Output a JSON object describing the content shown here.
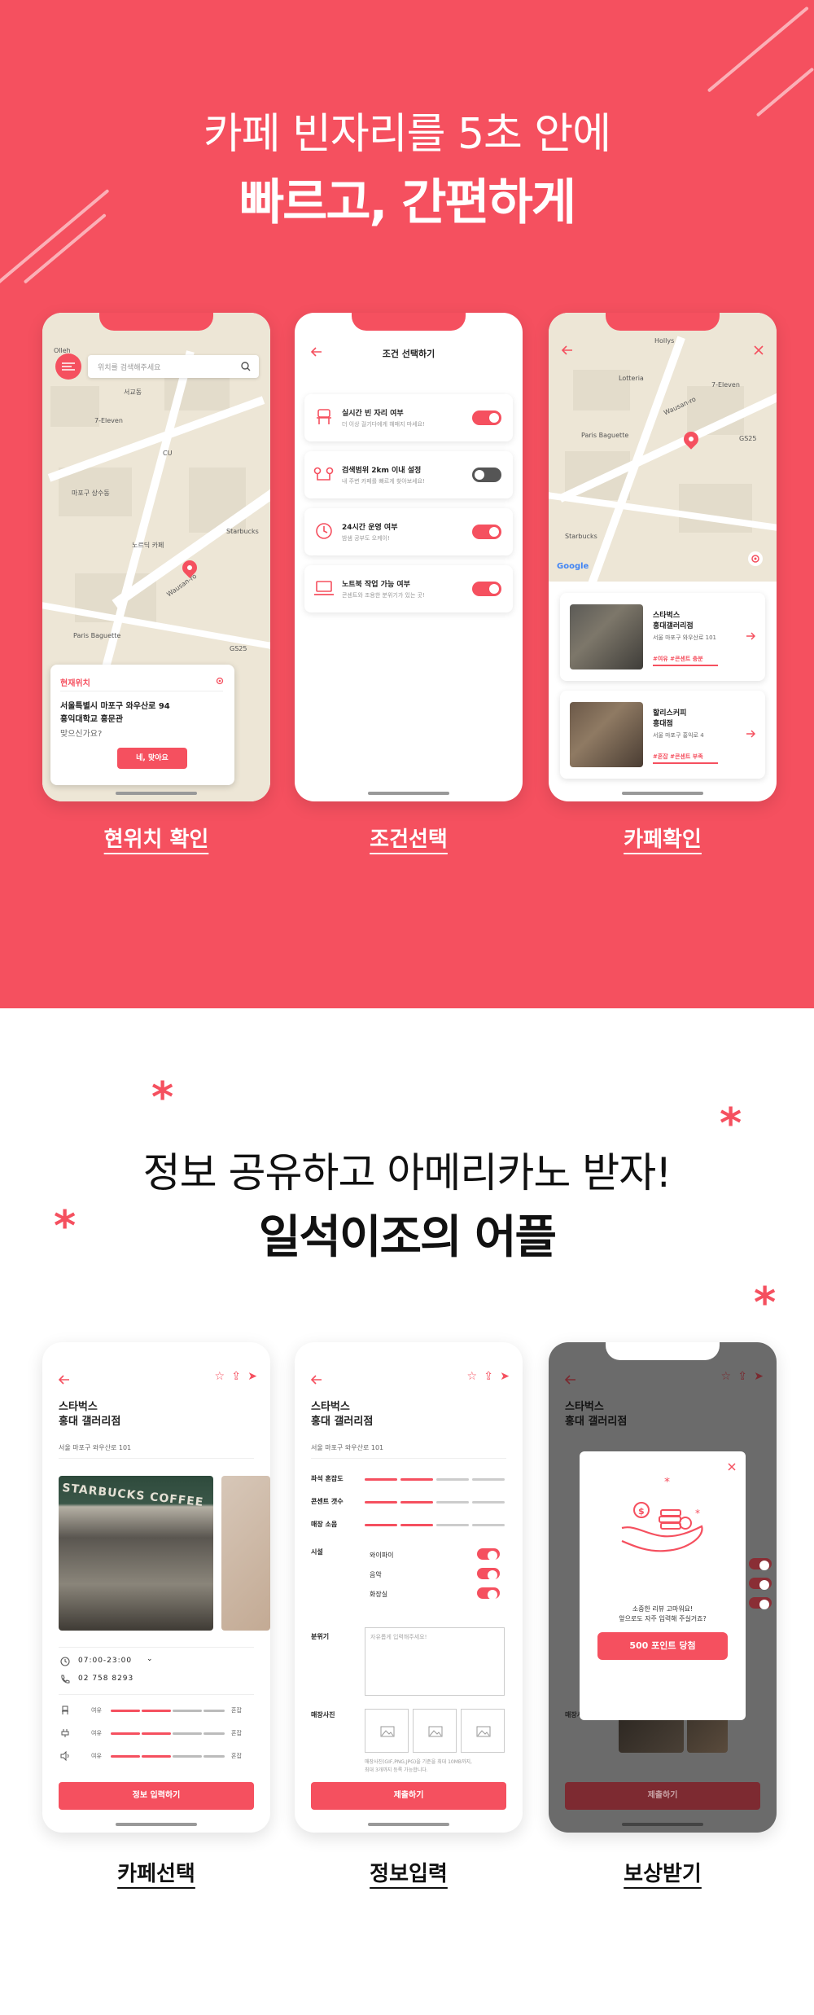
{
  "hero": {
    "line1": "카페 빈자리를 5초 안에",
    "line2": "빠르고, 간편하게"
  },
  "colors": {
    "accent": "#f5505f",
    "dark_gray": "#6b6b6b"
  },
  "screen1": {
    "search_placeholder": "위치를 검색해주세요",
    "card_title": "현재위치",
    "address": "서울특별시 마포구 와우산로 94",
    "place": "홍익대학교 홍문관",
    "question": "맞으신가요?",
    "confirm": "네, 맞아요",
    "map_labels": [
      "Olleh",
      "7-Eleven",
      "서교동",
      "CU",
      "Starbucks",
      "Paris Baguette",
      "Wausan-ro",
      "GS25",
      "노르딕 카페",
      "마포구 상수동"
    ],
    "caption": "현위치 확인"
  },
  "screen2": {
    "title": "조건 선택하기",
    "conditions": [
      {
        "title": "실시간 빈 자리 여부",
        "desc": "더 이상 걸기다에게 헤매지 마세요!",
        "icon": "chair-icon",
        "on": true
      },
      {
        "title": "검색범위 2km 이내 설정",
        "desc": "내 주변 카페를 빠르게 찾아보세요!",
        "icon": "route-icon",
        "on": false
      },
      {
        "title": "24시간 운영 여부",
        "desc": "밤샘 공부도 오케이!",
        "icon": "clock-icon",
        "on": true
      },
      {
        "title": "노트북 작업 가능 여부",
        "desc": "콘센트와 조용한 분위기가 있는 곳!",
        "icon": "laptop-icon",
        "on": true
      }
    ],
    "caption": "조건선택"
  },
  "screen3": {
    "map_labels": [
      "Hollys",
      "Lotteria",
      "7-Eleven",
      "Paris Baguette",
      "GS25",
      "Starbucks",
      "Wausan-ro",
      "Google"
    ],
    "cafes": [
      {
        "name": "스타벅스",
        "branch": "홍대갤러리점",
        "address": "서울 마포구 와우산로 101",
        "tags": "#여유 #콘센트 충분"
      },
      {
        "name": "할리스커피",
        "branch": "홍대점",
        "address": "서울 마포구 홍익로 4",
        "tags": "#혼잡 #콘센트 부족"
      }
    ],
    "caption": "카페확인"
  },
  "section2": {
    "line1": "정보 공유하고 아메리카노 받자!",
    "line2": "일석이조의 어플"
  },
  "screen4": {
    "name": "스타벅스",
    "branch": "홍대 갤러리점",
    "address": "서울 마포구 와우산로 101",
    "hours": "07:00-23:00",
    "phone": "02 758 8293",
    "status_rows": [
      {
        "label": "여유",
        "value": "혼잡",
        "icon": "chair-icon"
      },
      {
        "label": "여유",
        "value": "혼잡",
        "icon": "plug-icon"
      },
      {
        "label": "여유",
        "value": "혼잡",
        "icon": "sound-icon"
      }
    ],
    "button": "정보 입력하기",
    "caption": "카페선택"
  },
  "screen5": {
    "name": "스타벅스",
    "branch": "홍대 갤러리점",
    "address": "서울 마포구 와우산로 101",
    "ratings": [
      {
        "label": "좌석 혼잡도",
        "level": 2
      },
      {
        "label": "콘센트 갯수",
        "level": 2
      },
      {
        "label": "매장 소음",
        "level": 2
      }
    ],
    "facility_label": "시설",
    "facilities": [
      "와이파이",
      "음악",
      "화장실"
    ],
    "mood_label": "분위기",
    "mood_placeholder": "자유롭게 입력해주세요!",
    "photo_label": "매장사진",
    "photo_note1": "매장사진(GIF,PNG,JPG)을 기준을 최대 10MB까지,",
    "photo_note2": "최대 3개까지 등록 가능합니다.",
    "submit": "제출하기",
    "caption": "정보입력"
  },
  "screen6": {
    "name": "스타벅스",
    "branch": "홍대 갤러리점",
    "popup_line1": "소중한 리뷰 고마워요!",
    "popup_line2": "앞으로도 자주 입력해 주실거죠?",
    "reward_button": "500 포인트 당첨",
    "photo_label": "매장사진",
    "submit": "제출하기",
    "caption": "보상받기"
  }
}
